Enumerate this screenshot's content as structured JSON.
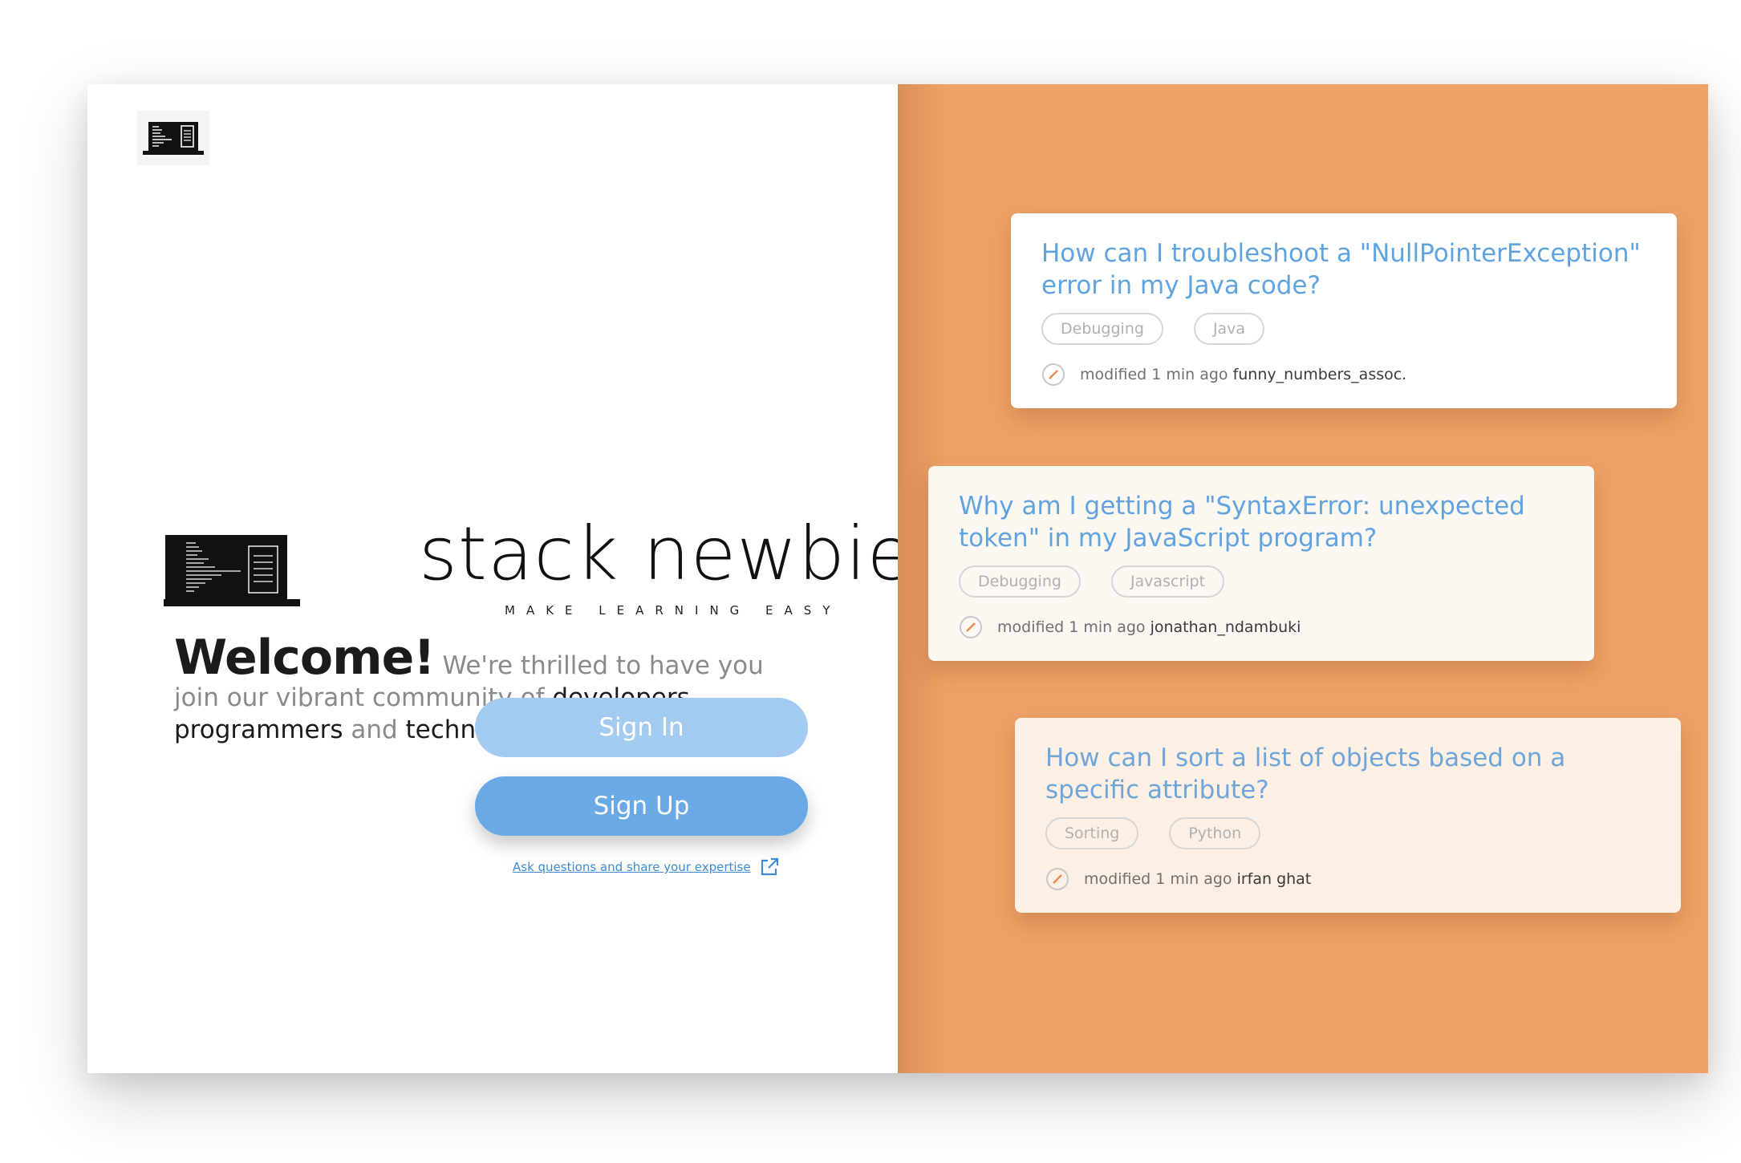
{
  "brand": {
    "name": "stack newbie",
    "tagline": "MAKE LEARNING EASY"
  },
  "welcome": {
    "heading": "Welcome!",
    "text_1": " We're thrilled to have you join our vibrant community of ",
    "highlight_1": "developers, programmers",
    "text_2": " and ",
    "highlight_2": "technology enthusiasts."
  },
  "buttons": {
    "sign_in": "Sign In",
    "sign_up": "Sign Up"
  },
  "ask_link": "Ask questions and share your expertise",
  "colors": {
    "accent_orange": "#eea267",
    "sign_in_blue": "#a3cbef",
    "sign_up_blue": "#6aa9e5",
    "title_blue": "#5fa3e0"
  },
  "questions": [
    {
      "title": "How can I troubleshoot a \"NullPointerException\" error in my Java code?",
      "tags": [
        "Debugging",
        "Java"
      ],
      "modified": "modified 1 min ago",
      "user": "funny_numbers_assoc."
    },
    {
      "title": "Why am I getting a \"SyntaxError: unexpected token\" in my JavaScript program?",
      "tags": [
        "Debugging",
        "Javascript"
      ],
      "modified": "modified 1 min ago",
      "user": "jonathan_ndambuki"
    },
    {
      "title": "How can I sort a list of objects based on a specific attribute?",
      "tags": [
        "Sorting",
        "Python"
      ],
      "modified": "modified 1 min ago",
      "user": "irfan ghat"
    }
  ],
  "icons": {
    "logo": "laptop-code-icon",
    "external_link": "external-link-icon",
    "edit": "pencil-circle-icon"
  }
}
